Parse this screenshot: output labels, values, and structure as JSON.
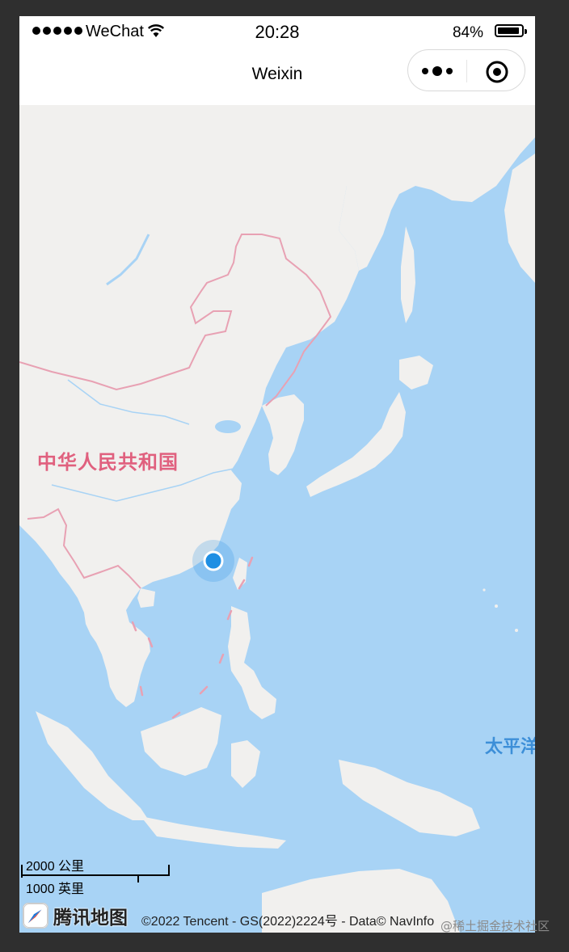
{
  "status_bar": {
    "carrier": "WeChat",
    "time": "20:28",
    "battery_percent": "84%",
    "battery_level": 0.84
  },
  "nav": {
    "title": "Weixin",
    "more_icon": "more-dots-icon",
    "close_icon": "target-close-icon"
  },
  "map": {
    "country_label": "中华人民共和国",
    "ocean_label": "太平洋",
    "scale_metric": "2000 公里",
    "scale_imperial": "1000 英里",
    "provider_logo_text": "腾讯地图",
    "copyright": "©2022 Tencent - GS(2022)2224号 - Data© NavInfo",
    "colors": {
      "water": "#a8d3f5",
      "land": "#f1f0ee",
      "border": "#e8a1b3",
      "location_dot": "#1f8fe3"
    }
  },
  "watermark": "@稀土掘金技术社区"
}
